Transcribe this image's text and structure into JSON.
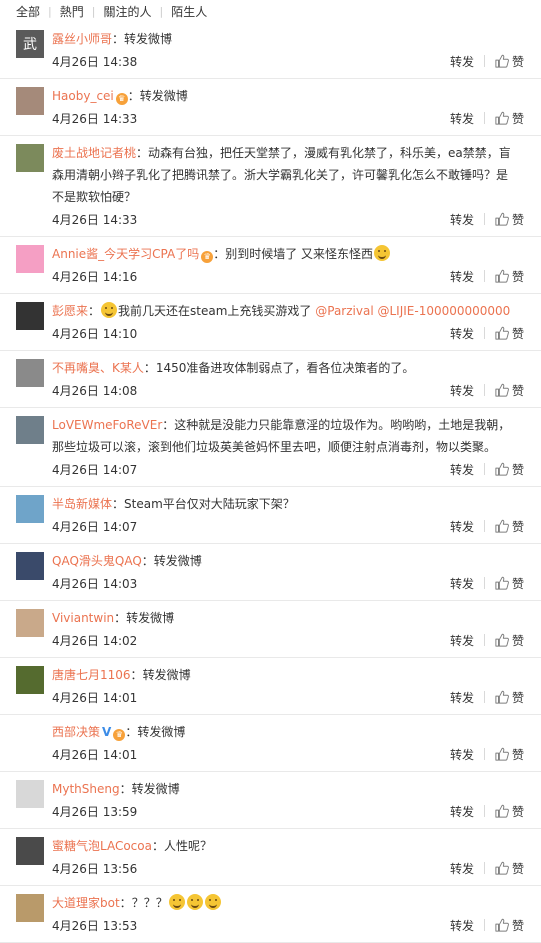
{
  "filters": [
    "全部",
    "熱門",
    "關注的人",
    "陌生人"
  ],
  "labels": {
    "repost": "转发",
    "like": "赞",
    "sep": "："
  },
  "icons": {
    "like": "thumbs-up-icon",
    "emoji": "smiley-emoji"
  },
  "colors": {
    "username": "#eb7350",
    "text": "#333333",
    "divider": "#e9e9e9"
  },
  "comments": [
    {
      "user": "露丝小师哥",
      "segments": [
        "转发微博"
      ],
      "time": "4月26日 14:38",
      "avatar_color": "#5a5a5a",
      "avatar_glyph": "武"
    },
    {
      "user": "Haoby_cei",
      "badge": "vip",
      "segments": [
        "转发微博"
      ],
      "time": "4月26日 14:33",
      "avatar_color": "#a58a7a",
      "avatar_glyph": ""
    },
    {
      "user": "废土战地记者桃",
      "segments": [
        "动森有台独，把任天堂禁了，漫威有乳化禁了，科乐美，ea禁禁，盲森用清朝小辫子乳化了把腾讯禁了。浙大学霸乳化关了，许可馨乳化怎么不敢锤吗？是不是欺软怕硬？"
      ],
      "time": "4月26日 14:33",
      "avatar_color": "#7c8a5c",
      "avatar_glyph": ""
    },
    {
      "user": "Annie酱_今天学习CPA了吗",
      "badge": "vip",
      "segments": [
        "别到时候墙了 又来怪东怪西"
      ],
      "emoji_after": 1,
      "time": "4月26日 14:16",
      "avatar_color": "#f59fc4",
      "avatar_glyph": ""
    },
    {
      "user": "彭愿来",
      "lead_emoji": 1,
      "segments": [
        "我前几天还在steam上充钱买游戏了"
      ],
      "mentions": [
        "@Parzival",
        "@LIJIE-100000000000"
      ],
      "time": "4月26日 14:10",
      "avatar_color": "#333333",
      "avatar_glyph": ""
    },
    {
      "user": "不再嘴臭、K某人",
      "segments": [
        "1450准备进攻体制弱点了，看各位决策者的了。"
      ],
      "time": "4月26日 14:08",
      "avatar_color": "#8a8a8a",
      "avatar_glyph": ""
    },
    {
      "user": "LoVEWmeFoReVEr",
      "segments": [
        "这种就是没能力只能靠意淫的垃圾作为。哟哟哟，土地是我朝，那些垃圾可以滚，滚到他们垃圾英美爸妈怀里去吧，顺便注射点消毒剂，物以类聚。"
      ],
      "time": "4月26日 14:07",
      "avatar_color": "#6f7f8a",
      "avatar_glyph": ""
    },
    {
      "user": "半岛新媒体",
      "segments": [
        "Steam平台仅对大陆玩家下架？"
      ],
      "time": "4月26日 14:07",
      "avatar_color": "#6fa4c9",
      "avatar_glyph": ""
    },
    {
      "user": "QAQ滑头鬼QAQ",
      "segments": [
        "转发微博"
      ],
      "time": "4月26日 14:03",
      "avatar_color": "#3a4a6a",
      "avatar_glyph": ""
    },
    {
      "user": "Viviantwin",
      "segments": [
        "转发微博"
      ],
      "time": "4月26日 14:02",
      "avatar_color": "#c9a98a",
      "avatar_glyph": ""
    },
    {
      "user": "唐唐七月1106",
      "segments": [
        "转发微博"
      ],
      "time": "4月26日 14:01",
      "avatar_color": "#556b2f",
      "avatar_glyph": ""
    },
    {
      "user": "西部决策",
      "verified": 1,
      "badge": "vip",
      "segments": [
        "转发微博"
      ],
      "time": "4月26日 14:01",
      "avatar_color": "#ffffff",
      "avatar_glyph": ""
    },
    {
      "user": "MythSheng",
      "segments": [
        "转发微博"
      ],
      "time": "4月26日 13:59",
      "avatar_color": "#d8d8d8",
      "avatar_glyph": ""
    },
    {
      "user": "蜜糖气泡LACocoa",
      "segments": [
        "人性呢？"
      ],
      "time": "4月26日 13:56",
      "avatar_color": "#4a4a4a",
      "avatar_glyph": ""
    },
    {
      "user": "大道理家bot",
      "segments": [
        "？？？"
      ],
      "emoji_after": 3,
      "time": "4月26日 13:53",
      "avatar_color": "#b99a6a",
      "avatar_glyph": ""
    }
  ]
}
